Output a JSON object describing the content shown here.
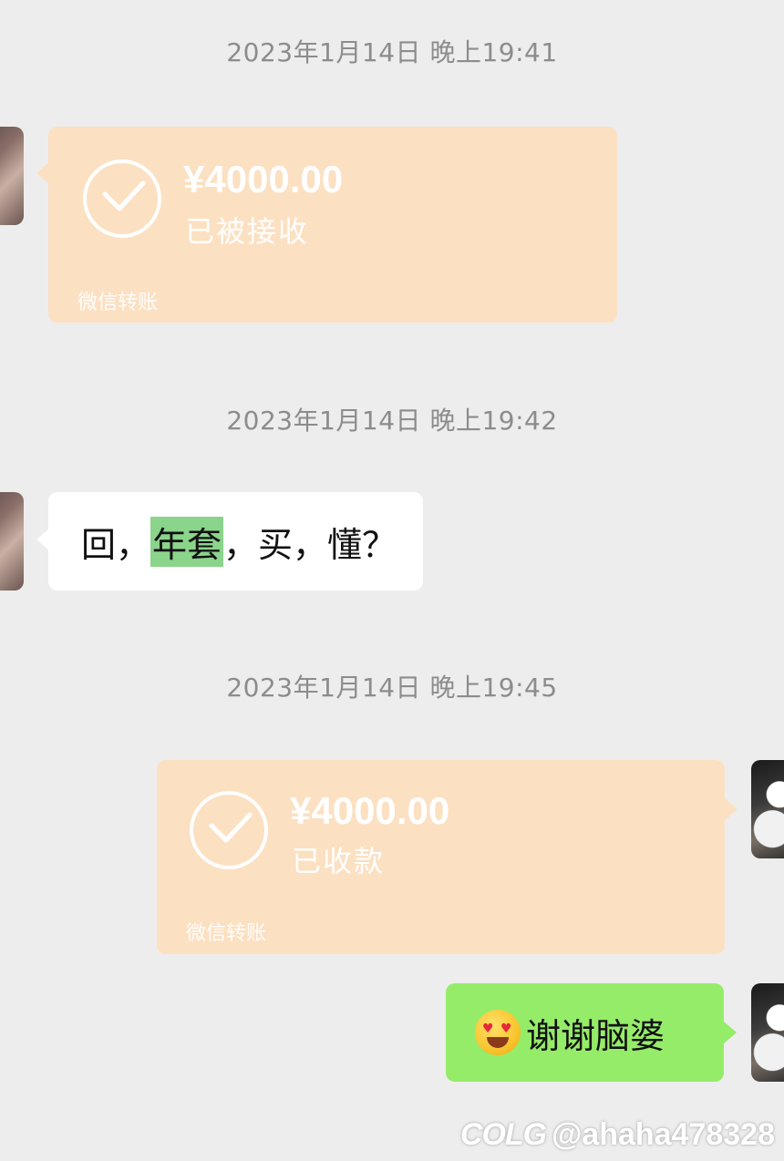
{
  "messages": {
    "ts1": "2023年1月14日 晚上19:41",
    "transfer1": {
      "amount": "¥4000.00",
      "status": "已被接收",
      "brand": "微信转账"
    },
    "ts2": "2023年1月14日 晚上19:42",
    "text1": {
      "part1": "回，",
      "highlight": "年套",
      "part2": "，买，懂？"
    },
    "ts3": "2023年1月14日 晚上19:45",
    "transfer2": {
      "amount": "¥4000.00",
      "status": "已收款",
      "brand": "微信转账"
    },
    "text2": {
      "content": "谢谢脑婆",
      "emoji": "heart-eyes-emoji"
    }
  },
  "watermark": {
    "logo": "COLG",
    "handle": "@ahaha478328"
  },
  "colors": {
    "background": "#ededed",
    "transfer_bubble": "#fce0c2",
    "sent_bubble": "#95ec69",
    "received_bubble": "#ffffff",
    "highlight": "#8bd48b"
  }
}
